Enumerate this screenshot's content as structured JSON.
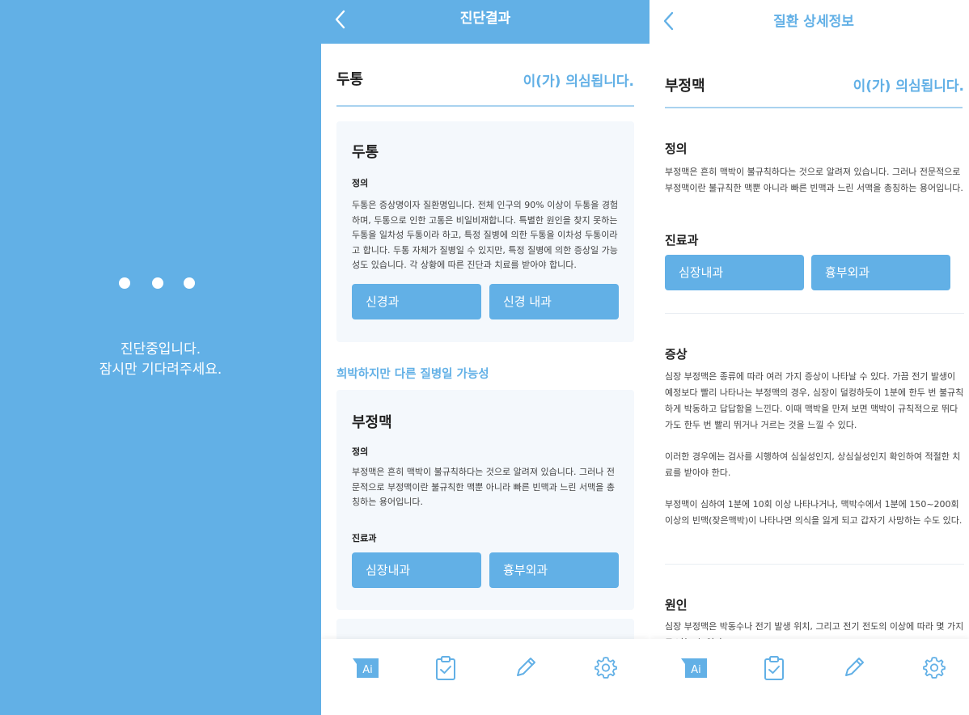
{
  "loading": {
    "line1": "진단중입니다.",
    "line2": "잠시만 기다려주세요."
  },
  "result": {
    "title": "진단결과",
    "disease": "두통",
    "suspected": "이(가) 의심됩니다.",
    "card1": {
      "title": "두통",
      "definition_label": "정의",
      "definition": "두통은 증상명이자 질환명입니다. 전체 인구의 90% 이상이 두통을 경험하며, 두통으로 인한 고통은 비일비재합니다. 특별한 원인을 찾지 못하는 두통을 일차성 두통이라 하고, 특정 질병에 의한 두통을 이차성 두통이라고 합니다. 두통 자체가 질병일 수 있지만, 특정 질병에 의한 증상일 가능성도 있습니다. 각 상황에 따른 진단과 치료를 받아야 합니다.",
      "dept1": "신경과",
      "dept2": "신경 내과"
    },
    "alt_label": "희박하지만 다른 질병일 가능성",
    "card2": {
      "title": "부정맥",
      "definition_label": "정의",
      "definition": "부정맥은 흔히 맥박이 불규칙하다는 것으로 알려져 있습니다. 그러나 전문적으로 부정맥이란 불규칙한 맥뿐 아니라 빠른 빈맥과 느린 서맥을 총칭하는 용어입니다.",
      "dept_label": "진료과",
      "dept1": "심장내과",
      "dept2": "흉부외과"
    }
  },
  "detail": {
    "title": "질환 상세정보",
    "disease": "부정맥",
    "suspected": "이(가) 의심됩니다.",
    "definition_label": "정의",
    "definition": "부정맥은 흔히 맥박이 불규칙하다는 것으로 알려져 있습니다. 그러나 전문적으로 부정맥이란 불규칙한 맥뿐 아니라 빠른 빈맥과 느린 서맥을 총칭하는 용어입니다.",
    "dept_label": "진료과",
    "dept1": "심장내과",
    "dept2": "흉부외과",
    "symptom_label": "증상",
    "symptom_p1": "심장 부정맥은 종류에 따라 여러 가지 증상이 나타날 수 있다. 가끔 전기 발생이 예정보다 빨리 나타나는 부정맥의 경우, 심장이 덜컹하듯이 1분에 한두 번 불규칙하게 박동하고 답답함을 느낀다. 이때 맥박을 만져 보면 맥박이 규칙적으로 뛰다가도 한두 번 빨리 뛰거나 거르는 것을 느낄 수 있다.",
    "symptom_p2": "이러한 경우에는 검사를 시행하여 심실성인지, 상심실성인지 확인하여 적절한 치료를 받아야 한다.",
    "symptom_p3": "부정맥이 심하여 1분에 10회 이상 나타나거나, 맥박수에서 1분에 150~200회 이상의 빈맥(잦은맥박)이 나타나면 의식을 잃게 되고 갑자기 사망하는 수도 있다.",
    "cause_label": "원인",
    "cause": "심장 부정맥은 박동수나 전기 발생 위치, 그리고 전기 전도의 이상에 따라 몇 가지로 나눌 수 있다."
  },
  "tabs": {
    "ai_label": "Ai",
    "icons": [
      "ai-icon",
      "clipboard-check-icon",
      "pencil-icon",
      "gear-icon"
    ]
  },
  "colors": {
    "accent": "#62b0e6",
    "card_bg": "#f4f8fc",
    "divider": "#a9d2ef"
  }
}
